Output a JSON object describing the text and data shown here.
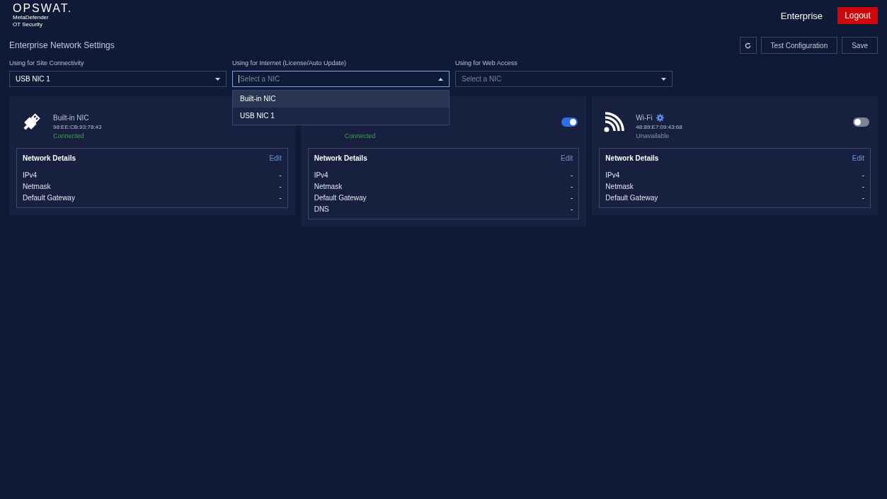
{
  "header": {
    "logo": "OPSWAT.",
    "product_line_1": "MetaDefender",
    "product_line_2": "OT Security",
    "mode": "Enterprise",
    "logout": "Logout"
  },
  "page_title": "Enterprise Network Settings",
  "actions": {
    "test": "Test Configuration",
    "save": "Save"
  },
  "selects": [
    {
      "label": "Using for Site Connectivity",
      "value": "USB NIC 1",
      "expanded": false
    },
    {
      "label": "Using for Internet (License/Auto Update)",
      "placeholder": "Select a NIC",
      "expanded": true,
      "options": [
        {
          "label": "Built-in NIC",
          "selected": true
        },
        {
          "label": "USB NIC 1",
          "selected": false
        }
      ]
    },
    {
      "label": "Using for Web Access",
      "placeholder": "Select a NIC",
      "expanded": false
    }
  ],
  "cards": [
    {
      "kind": "usb",
      "name": "Built-in NIC",
      "mac": "98:EE:CB:93:78:43",
      "status": "Connected",
      "connected": true,
      "details_title": "Network Details",
      "edit": "Edit",
      "rows": [
        {
          "label": "IPv4",
          "value": "-"
        },
        {
          "label": "Netmask",
          "value": "-"
        },
        {
          "label": "Default Gateway",
          "value": "-"
        }
      ]
    },
    {
      "kind": "hidden",
      "status": "Connected",
      "connected": true,
      "toggle": {
        "on": true
      },
      "details_title": "Network Details",
      "edit": "Edit",
      "rows": [
        {
          "label": "IPv4",
          "value": "-"
        },
        {
          "label": "Netmask",
          "value": "-"
        },
        {
          "label": "Default Gateway",
          "value": "-"
        },
        {
          "label": "DNS",
          "value": "-"
        }
      ]
    },
    {
      "kind": "wifi",
      "name": "Wi-Fi",
      "settings": true,
      "mac": "48:89:E7:09:43:68",
      "status": "Unavailable",
      "connected": false,
      "toggle": {
        "on": false
      },
      "details_title": "Network Details",
      "edit": "Edit",
      "rows": [
        {
          "label": "IPv4",
          "value": "-"
        },
        {
          "label": "Netmask",
          "value": "-"
        },
        {
          "label": "Default Gateway",
          "value": "-"
        }
      ]
    }
  ]
}
